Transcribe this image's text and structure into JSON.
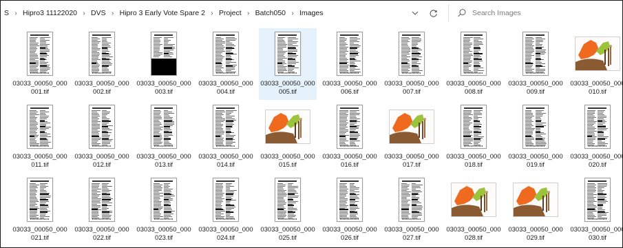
{
  "address_bar": {
    "crumbs": [
      "S",
      "Hipro3 11122020",
      "DVS",
      "Hipro 3 Early Vote Spare 2",
      "Project",
      "Batch050",
      "Images"
    ]
  },
  "search": {
    "placeholder": "Search Images"
  },
  "colors": {
    "selection": "#e5f1fb",
    "orange": "#ef6a1f",
    "green": "#9bc43c",
    "brown": "#8a5a32"
  },
  "files": [
    {
      "line1": "03033_00050_000",
      "line2": "001.tif",
      "thumb": "doc"
    },
    {
      "line1": "03033_00050_000",
      "line2": "002.tif",
      "thumb": "doc"
    },
    {
      "line1": "03033_00050_000",
      "line2": "003.tif",
      "thumb": "doc-black"
    },
    {
      "line1": "03033_00050_000",
      "line2": "004.tif",
      "thumb": "doc"
    },
    {
      "line1": "03033_00050_000",
      "line2": "005.tif",
      "thumb": "doc",
      "selected": true
    },
    {
      "line1": "03033_00050_000",
      "line2": "006.tif",
      "thumb": "doc"
    },
    {
      "line1": "03033_00050_000",
      "line2": "007.tif",
      "thumb": "doc"
    },
    {
      "line1": "03033_00050_000",
      "line2": "008.tif",
      "thumb": "doc"
    },
    {
      "line1": "03033_00050_000",
      "line2": "009.tif",
      "thumb": "doc"
    },
    {
      "line1": "03033_00050_000",
      "line2": "010.tif",
      "thumb": "art"
    },
    {
      "line1": "03033_00050_000",
      "line2": "011.tif",
      "thumb": "doc"
    },
    {
      "line1": "03033_00050_000",
      "line2": "012.tif",
      "thumb": "doc"
    },
    {
      "line1": "03033_00050_000",
      "line2": "013.tif",
      "thumb": "doc"
    },
    {
      "line1": "03033_00050_000",
      "line2": "014.tif",
      "thumb": "doc"
    },
    {
      "line1": "03033_00050_000",
      "line2": "015.tif",
      "thumb": "art"
    },
    {
      "line1": "03033_00050_000",
      "line2": "016.tif",
      "thumb": "doc"
    },
    {
      "line1": "03033_00050_000",
      "line2": "017.tif",
      "thumb": "art"
    },
    {
      "line1": "03033_00050_000",
      "line2": "018.tif",
      "thumb": "doc"
    },
    {
      "line1": "03033_00050_000",
      "line2": "019.tif",
      "thumb": "doc"
    },
    {
      "line1": "03033_00050_000",
      "line2": "020.tif",
      "thumb": "doc"
    },
    {
      "line1": "03033_00050_000",
      "line2": "021.tif",
      "thumb": "doc"
    },
    {
      "line1": "03033_00050_000",
      "line2": "022.tif",
      "thumb": "doc"
    },
    {
      "line1": "03033_00050_000",
      "line2": "023.tif",
      "thumb": "doc"
    },
    {
      "line1": "03033_00050_000",
      "line2": "024.tif",
      "thumb": "doc"
    },
    {
      "line1": "03033_00050_000",
      "line2": "025.tif",
      "thumb": "doc"
    },
    {
      "line1": "03033_00050_000",
      "line2": "026.tif",
      "thumb": "doc"
    },
    {
      "line1": "03033_00050_000",
      "line2": "027.tif",
      "thumb": "doc"
    },
    {
      "line1": "03033_00050_000",
      "line2": "028.tif",
      "thumb": "art"
    },
    {
      "line1": "03033_00050_000",
      "line2": "029.tif",
      "thumb": "art"
    },
    {
      "line1": "03033_00050_000",
      "line2": "030.tif",
      "thumb": "doc"
    }
  ]
}
